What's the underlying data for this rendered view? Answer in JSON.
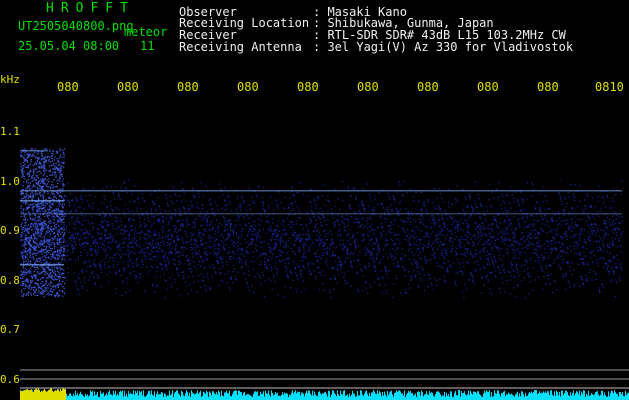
{
  "header": {
    "logo": "HROFFT",
    "filename": "UT2505040800.png",
    "meteor_label": "meteor",
    "datetime": "25.05.04 08:00",
    "count": "11",
    "observer_label": "Observer",
    "observer_value": ": Masaki Kano",
    "location_label": "Receiving Location",
    "location_value": ": Shibukawa, Gunma, Japan",
    "receiver_label": "Receiver",
    "receiver_value": ": RTL-SDR SDR# 43dB L15 103.2MHz CW",
    "antenna_label": "Receiving Antenna",
    "antenna_value": ": 3el Yagi(V) Az 330 for Vladivostok"
  },
  "axes": {
    "y_unit": "kHz",
    "y_ticks": [
      "1.1",
      "1.0",
      "0.9",
      "0.8",
      "0.7",
      "0.6"
    ],
    "x_ticks": [
      "080",
      "080",
      "080",
      "080",
      "080",
      "080",
      "080",
      "080",
      "080",
      "0810"
    ]
  },
  "colors": {
    "text_green": "#00e000",
    "text_white": "#f0f0f0",
    "tick_yellow": "#e0e000",
    "signal_blue": "#2a3cff",
    "baseline_cyan": "#00e0ff"
  }
}
